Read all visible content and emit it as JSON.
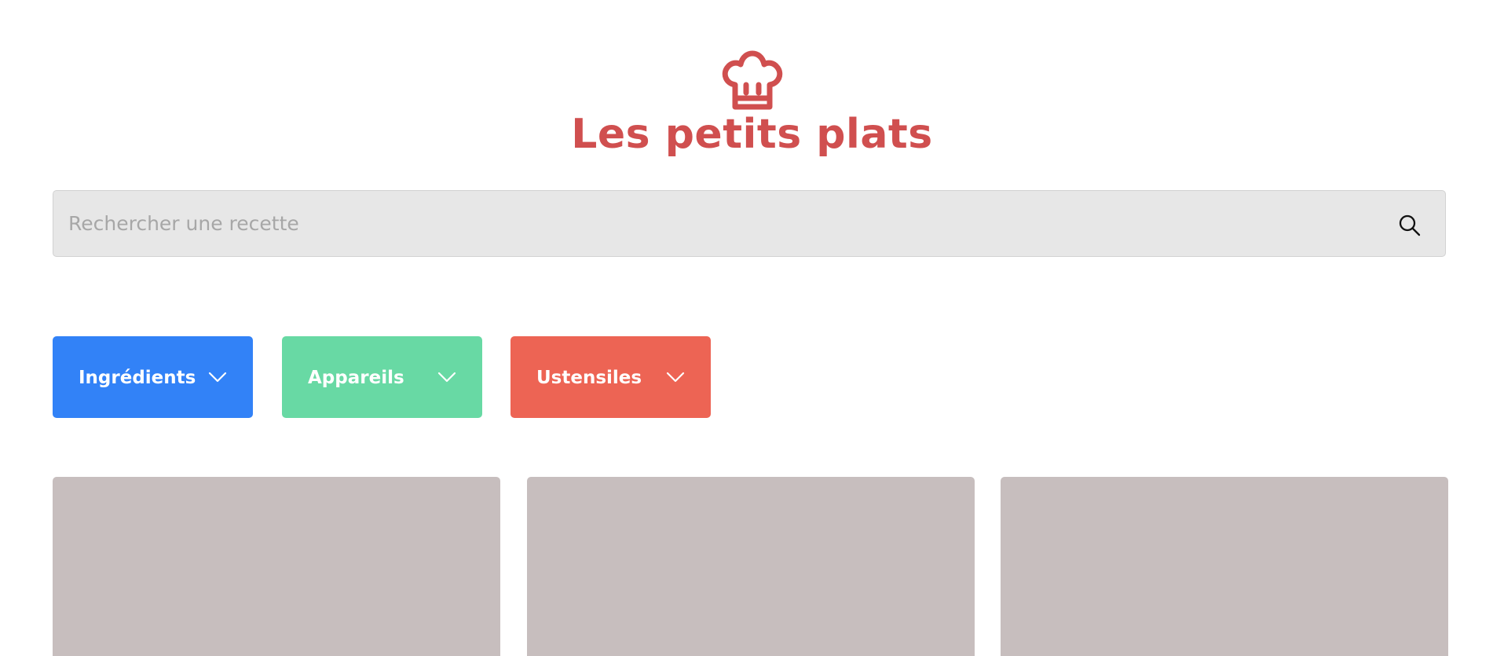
{
  "header": {
    "logo_icon": "chef-hat-icon",
    "title": "Les petits plats",
    "brand_color": "#d04f4f"
  },
  "search": {
    "placeholder": "Rechercher une recette",
    "value": "",
    "icon": "search-icon",
    "background": "#e7e7e7"
  },
  "filters": [
    {
      "label": "Ingrédients",
      "color": "#3282f7",
      "icon": "chevron-down-icon"
    },
    {
      "label": "Appareils",
      "color": "#68d9a4",
      "icon": "chevron-down-icon"
    },
    {
      "label": "Ustensiles",
      "color": "#ed6454",
      "icon": "chevron-down-icon"
    }
  ],
  "recipes": {
    "card_image_color": "#c7bebe",
    "cards": [
      {
        "image": "recipe-image-placeholder"
      },
      {
        "image": "recipe-image-placeholder"
      },
      {
        "image": "recipe-image-placeholder"
      }
    ]
  }
}
